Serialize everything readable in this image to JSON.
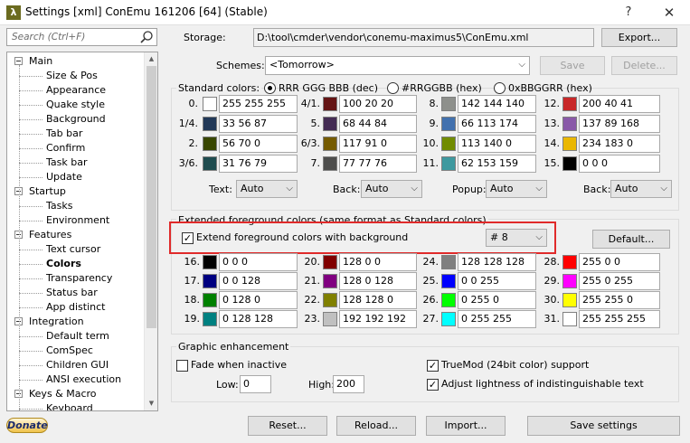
{
  "window": {
    "title": "Settings [xml] ConEmu 161206 [64] (Stable)",
    "app_icon_glyph": "λ",
    "help_glyph": "?",
    "close_glyph": "✕"
  },
  "search": {
    "placeholder": "Search (Ctrl+F)"
  },
  "tree": {
    "selected": "Colors",
    "items": [
      {
        "label": "Main",
        "level": 0
      },
      {
        "label": "Size & Pos",
        "level": 1
      },
      {
        "label": "Appearance",
        "level": 1
      },
      {
        "label": "Quake style",
        "level": 1
      },
      {
        "label": "Background",
        "level": 1
      },
      {
        "label": "Tab bar",
        "level": 1
      },
      {
        "label": "Confirm",
        "level": 1
      },
      {
        "label": "Task bar",
        "level": 1
      },
      {
        "label": "Update",
        "level": 1
      },
      {
        "label": "Startup",
        "level": 0
      },
      {
        "label": "Tasks",
        "level": 1
      },
      {
        "label": "Environment",
        "level": 1
      },
      {
        "label": "Features",
        "level": 0
      },
      {
        "label": "Text cursor",
        "level": 1
      },
      {
        "label": "Colors",
        "level": 1
      },
      {
        "label": "Transparency",
        "level": 1
      },
      {
        "label": "Status bar",
        "level": 1
      },
      {
        "label": "App distinct",
        "level": 1
      },
      {
        "label": "Integration",
        "level": 0
      },
      {
        "label": "Default term",
        "level": 1
      },
      {
        "label": "ComSpec",
        "level": 1
      },
      {
        "label": "Children GUI",
        "level": 1
      },
      {
        "label": "ANSI execution",
        "level": 1
      },
      {
        "label": "Keys & Macro",
        "level": 0
      },
      {
        "label": "Keyboard",
        "level": 1
      }
    ]
  },
  "storage": {
    "label": "Storage:",
    "path": "D:\\tool\\cmder\\vendor\\conemu-maximus5\\ConEmu.xml",
    "export_label": "Export..."
  },
  "schemes": {
    "label": "Schemes:",
    "selected": "<Tomorrow>",
    "save_label": "Save",
    "delete_label": "Delete..."
  },
  "standard": {
    "title": "Standard colors:",
    "formats": [
      {
        "label": "RRR GGG BBB (dec)",
        "checked": true
      },
      {
        "label": "#RRGGBB (hex)",
        "checked": false
      },
      {
        "label": "0xBBGGRR (hex)",
        "checked": false
      }
    ],
    "colors": [
      {
        "index": "0.",
        "value": "255 255 255",
        "hex": "#ffffff"
      },
      {
        "index": "1/4.",
        "value": "33 56 87",
        "hex": "#213857"
      },
      {
        "index": "2.",
        "value": "56 70 0",
        "hex": "#384600"
      },
      {
        "index": "3/6.",
        "value": "31 76 79",
        "hex": "#1f4c4f"
      },
      {
        "index": "4/1.",
        "value": "100 20 20",
        "hex": "#641414"
      },
      {
        "index": "5.",
        "value": "68 44 84",
        "hex": "#442c54"
      },
      {
        "index": "6/3.",
        "value": "117 91 0",
        "hex": "#755b00"
      },
      {
        "index": "7.",
        "value": "77 77 76",
        "hex": "#4d4d4c"
      },
      {
        "index": "8.",
        "value": "142 144 140",
        "hex": "#8e908c"
      },
      {
        "index": "9.",
        "value": "66 113 174",
        "hex": "#4271ae"
      },
      {
        "index": "10.",
        "value": "113 140 0",
        "hex": "#718c00"
      },
      {
        "index": "11.",
        "value": "62 153 159",
        "hex": "#3e999f"
      },
      {
        "index": "12.",
        "value": "200 40 41",
        "hex": "#c82829"
      },
      {
        "index": "13.",
        "value": "137 89 168",
        "hex": "#8959a8"
      },
      {
        "index": "14.",
        "value": "234 183 0",
        "hex": "#eab700"
      },
      {
        "index": "15.",
        "value": "0 0 0",
        "hex": "#000000"
      }
    ],
    "selectors": [
      {
        "label": "Text:",
        "value": "Auto"
      },
      {
        "label": "Back:",
        "value": "Auto"
      },
      {
        "label": "Popup:",
        "value": "Auto"
      },
      {
        "label": "Back:",
        "value": "Auto"
      }
    ]
  },
  "extended": {
    "title": "Extended foreground colors (same format as Standard colors)",
    "checkbox_label": "Extend foreground colors with background",
    "checkbox_checked": true,
    "combo_value": "# 8",
    "default_label": "Default...",
    "colors": [
      {
        "index": "16.",
        "value": "0 0 0",
        "hex": "#000000"
      },
      {
        "index": "17.",
        "value": "0 0 128",
        "hex": "#000080"
      },
      {
        "index": "18.",
        "value": "0 128 0",
        "hex": "#008000"
      },
      {
        "index": "19.",
        "value": "0 128 128",
        "hex": "#008080"
      },
      {
        "index": "20.",
        "value": "128 0 0",
        "hex": "#800000"
      },
      {
        "index": "21.",
        "value": "128 0 128",
        "hex": "#800080"
      },
      {
        "index": "22.",
        "value": "128 128 0",
        "hex": "#808000"
      },
      {
        "index": "23.",
        "value": "192 192 192",
        "hex": "#c0c0c0"
      },
      {
        "index": "24.",
        "value": "128 128 128",
        "hex": "#808080"
      },
      {
        "index": "25.",
        "value": "0 0 255",
        "hex": "#0000ff"
      },
      {
        "index": "26.",
        "value": "0 255 0",
        "hex": "#00ff00"
      },
      {
        "index": "27.",
        "value": "0 255 255",
        "hex": "#00ffff"
      },
      {
        "index": "28.",
        "value": "255 0 0",
        "hex": "#ff0000"
      },
      {
        "index": "29.",
        "value": "255 0 255",
        "hex": "#ff00ff"
      },
      {
        "index": "30.",
        "value": "255 255 0",
        "hex": "#ffff00"
      },
      {
        "index": "31.",
        "value": "255 255 255",
        "hex": "#ffffff"
      }
    ]
  },
  "graphic": {
    "title": "Graphic enhancement",
    "fade_label": "Fade when inactive",
    "fade_checked": false,
    "low_label": "Low:",
    "low_value": "0",
    "high_label": "High:",
    "high_value": "200",
    "truemod_label": "TrueMod (24bit color) support",
    "truemod_checked": true,
    "adjust_label": "Adjust lightness of indistinguishable text",
    "adjust_checked": true
  },
  "footer": {
    "donate_label": "Donate",
    "reset_label": "Reset...",
    "reload_label": "Reload...",
    "import_label": "Import...",
    "save_settings_label": "Save settings"
  },
  "colors": {
    "highlight": "#e02a2a",
    "window_bg": "#f0f0f0"
  }
}
